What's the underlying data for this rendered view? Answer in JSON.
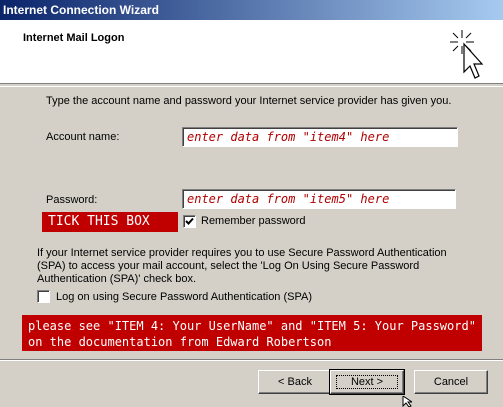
{
  "window": {
    "title": "Internet Connection Wizard"
  },
  "header": {
    "title": "Internet Mail Logon",
    "icon": "wizard-sparkle-cursor-icon"
  },
  "form": {
    "instructions": "Type the account name and password your Internet service provider has given you.",
    "account_label": "Account name:",
    "account_value": "enter data from \"item4\" here",
    "password_label": "Password:",
    "password_value": "enter data from \"item5\" here",
    "remember_label": "Remember password",
    "remember_checked": true,
    "spa_text": [
      "If your Internet service provider requires you to use Secure Password Authentication",
      "(SPA) to access your mail account, select the 'Log On Using Secure Password",
      "Authentication (SPA)' check box."
    ],
    "spa_label": "Log on using Secure Password Authentication (SPA)",
    "spa_checked": false
  },
  "annotations": {
    "tick_box": "TICK THIS BOX",
    "note_lines": [
      "please see \"ITEM 4: Your UserName\" and \"ITEM 5: Your Password\"",
      "on the documentation from Edward Robertson"
    ],
    "color": "#c00000"
  },
  "buttons": {
    "back": "< Back",
    "next": "Next >",
    "cancel": "Cancel"
  }
}
